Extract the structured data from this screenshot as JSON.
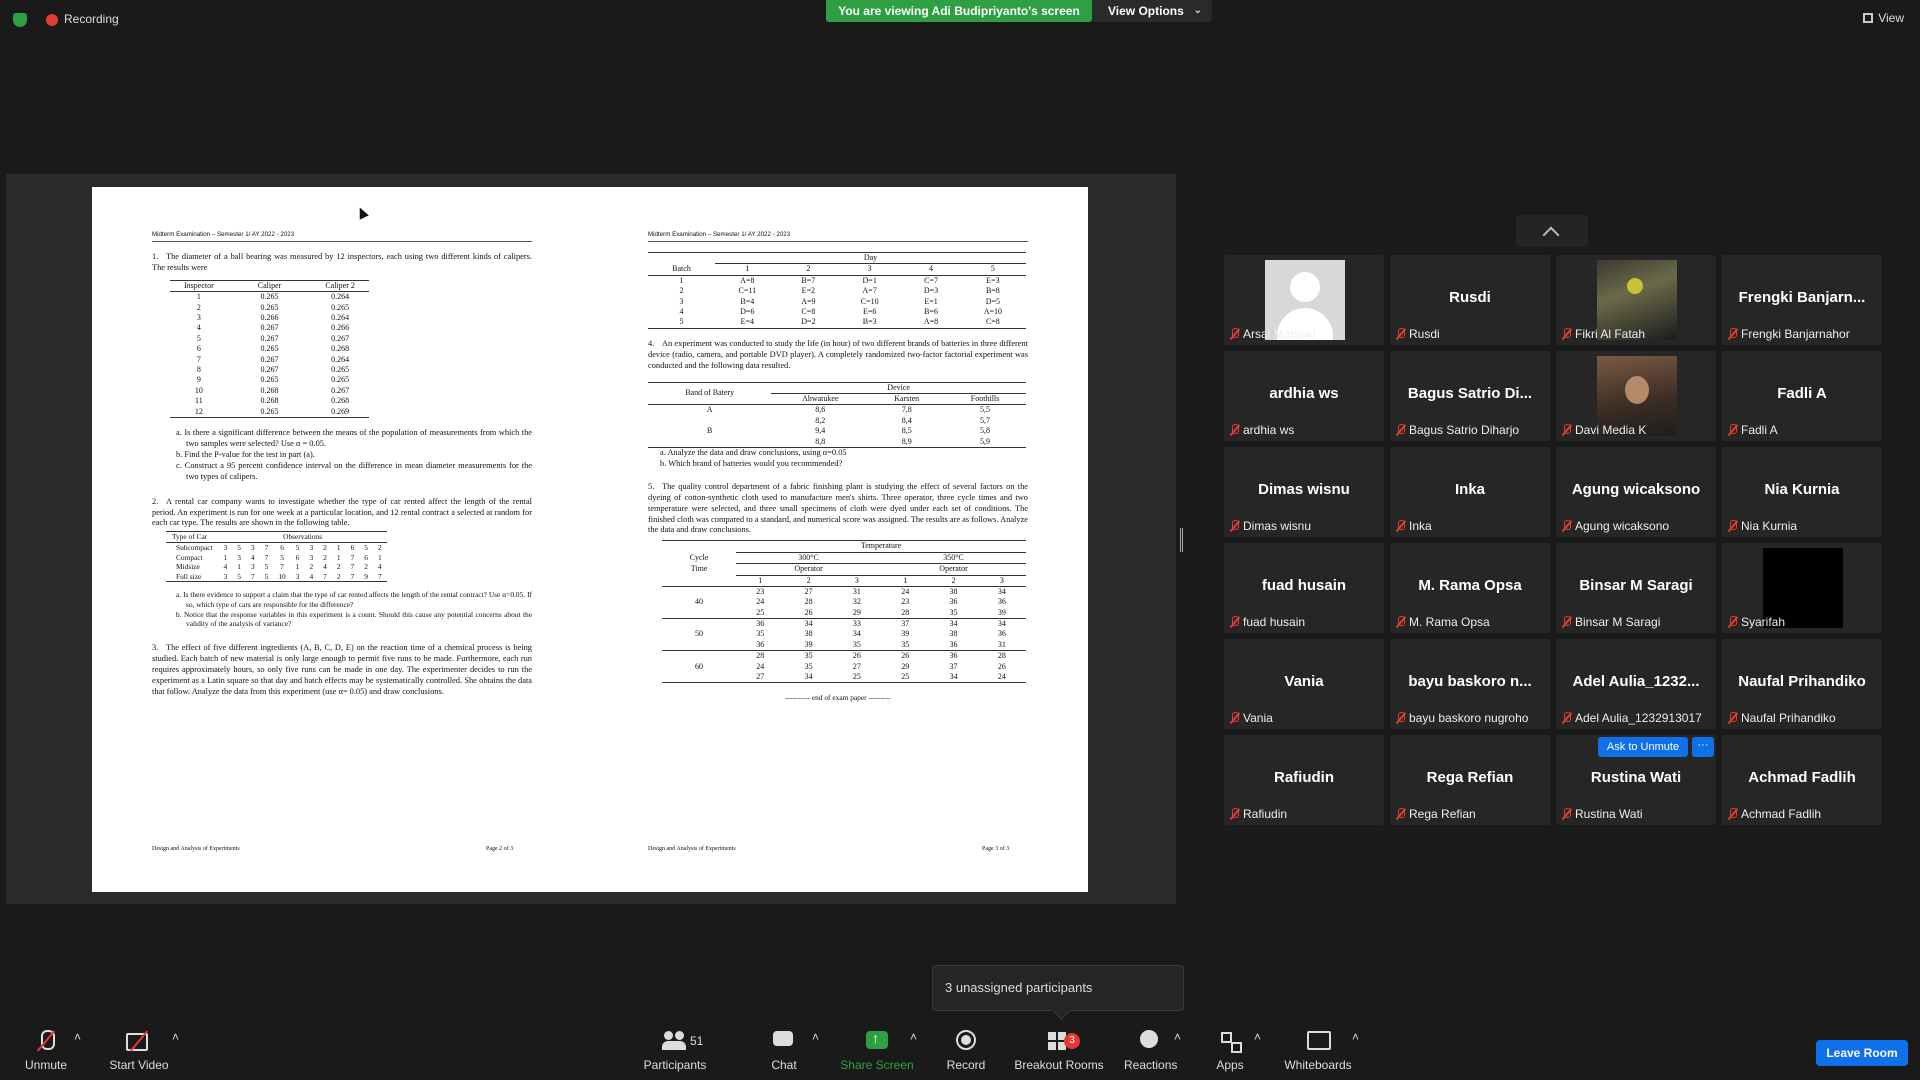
{
  "topbar": {
    "recording": "Recording",
    "banner": "You are viewing Adi Budipriyanto's screen",
    "view_options": "View Options",
    "view": "View"
  },
  "doc": {
    "page2": {
      "header": "Midterm Examination – Semester 1/ AY 2022 - 2023",
      "q1_num": "1.",
      "q1_text": "The diameter of a ball bearing was measured by 12 inspectors, each using two different kinds of calipers. The results were",
      "q1_table": {
        "headers": [
          "Inspector",
          "Caliper",
          "Caliper 2"
        ],
        "rows": [
          [
            "1",
            "0.265",
            "0.264"
          ],
          [
            "2",
            "0.265",
            "0.265"
          ],
          [
            "3",
            "0.266",
            "0.264"
          ],
          [
            "4",
            "0.267",
            "0.266"
          ],
          [
            "5",
            "0.267",
            "0.267"
          ],
          [
            "6",
            "0.265",
            "0.268"
          ],
          [
            "7",
            "0.267",
            "0.264"
          ],
          [
            "8",
            "0.267",
            "0.265"
          ],
          [
            "9",
            "0.265",
            "0.265"
          ],
          [
            "10",
            "0.268",
            "0.267"
          ],
          [
            "11",
            "0.268",
            "0.268"
          ],
          [
            "12",
            "0.265",
            "0.269"
          ]
        ]
      },
      "q1_a": "a. Is there a significant difference between the means of the population of measurements from which the two samples were selected? Use α = 0.05.",
      "q1_b": "b. Find the P-value for the test in part (a).",
      "q1_c": "c. Construct a 95 percent confidence interval on the difference in mean diameter measurements for the two types of calipers.",
      "q2_num": "2.",
      "q2_text": "A rental car company wants to investigate whether the type of car rented affect the length of the rental period. An experiment is run for one week at a particular location, and 12 rental contract a selected at random for each car type. The results are shown in the following table.",
      "q2_table": {
        "h_type": "Type of Car",
        "h_obs": "Observations",
        "rows": [
          {
            "label": "Subcompact",
            "values": [
              "3",
              "5",
              "3",
              "7",
              "6",
              "5",
              "3",
              "2",
              "1",
              "6",
              "5",
              "2"
            ]
          },
          {
            "label": "Compact",
            "values": [
              "1",
              "3",
              "4",
              "7",
              "5",
              "6",
              "3",
              "2",
              "1",
              "7",
              "6",
              "1"
            ]
          },
          {
            "label": "Midsize",
            "values": [
              "4",
              "1",
              "3",
              "5",
              "7",
              "1",
              "2",
              "4",
              "2",
              "7",
              "2",
              "4"
            ]
          },
          {
            "label": "Full size",
            "values": [
              "3",
              "5",
              "7",
              "5",
              "10",
              "3",
              "4",
              "7",
              "2",
              "7",
              "9",
              "7"
            ]
          }
        ]
      },
      "q2_a": "a. Is there evidence to support a claim that the type of car rented affects the length of the rental contract? Use α=0.05. If so, which type of cars are responsible for the difference?",
      "q2_b": "b. Notice that the response variables in this experiment is a count. Should this cause any potential concerns about the validity of the analysis of variance?",
      "q3_num": "3.",
      "q3_text": "The effect of five different ingredients (A, B, C, D, E) on the reaction time of a chemical process is being studied. Each batch of new material is only large enough to permit five runs to be made. Furthermore, each run requires approximately hours, so only five runs can be made in one day. The experimenter decides to run the experiment as a Latin square so that day and batch effects may be systematically controlled. She obtains the data that follow. Analyze the data from this experiment (use α= 0.05) and draw conclusions.",
      "footer_left": "Design and Analysis of Experiments",
      "footer_right": "Page 2 of 3"
    },
    "page3": {
      "header": "Midterm Examination – Semester 1/ AY 2022 - 2023",
      "latin": {
        "day": "Day",
        "cols": [
          "Batch",
          "1",
          "2",
          "3",
          "4",
          "5"
        ],
        "rows": [
          [
            "1",
            "A=8",
            "B=7",
            "D=1",
            "C=7",
            "E=3"
          ],
          [
            "2",
            "C=11",
            "E=2",
            "A=7",
            "D=3",
            "B=8"
          ],
          [
            "3",
            "B=4",
            "A=9",
            "C=10",
            "E=1",
            "D=5"
          ],
          [
            "4",
            "D=6",
            "C=8",
            "E=6",
            "B=6",
            "A=10"
          ],
          [
            "5",
            "E=4",
            "D=2",
            "B=3",
            "A=8",
            "C=8"
          ]
        ]
      },
      "q4_num": "4.",
      "q4_text": "An experiment was conducted to study the life (in hour) of two different brands of batteries in three different device (radio, camera, and portable DVD player). A completely randomized two-factor factorial experiment was conducted and the following data resulted.",
      "battery": {
        "band": "Band of Batery",
        "device": "Device",
        "cols": [
          "Ahwatukee",
          "Karsten",
          "Foothills"
        ],
        "rows": [
          [
            "A",
            "8,6",
            "7,8",
            "5,5"
          ],
          [
            "",
            "8,2",
            "8,4",
            "5,7"
          ],
          [
            "B",
            "9,4",
            "8,5",
            "5,8"
          ],
          [
            "",
            "8,8",
            "8,9",
            "5,9"
          ]
        ]
      },
      "q4_a": "a. Analyze the data and draw conclusions, using α=0.05",
      "q4_b": "b. Which brand of batteries would you recommended?",
      "q5_num": "5.",
      "q5_text": "The quality control department of a fabric finishing plant is studying the effect of several factors on the dyeing of cotton-synthetic cloth used to manufacture men's shirts. Three operator, three cycle times and two temperature were selected, and three small specimens of cloth were dyed under each set of conditions. The finished cloth was compared to a standard, and numerical score was assigned. The results are as follows. Analyze the data and draw conclusions.",
      "dye": {
        "cycle": "Cycle",
        "time": "Time",
        "temperature": "Temperature",
        "t1": "300°C",
        "t2": "350°C",
        "operator": "Operator",
        "ops": [
          "1",
          "2",
          "3",
          "1",
          "2",
          "3"
        ],
        "groups": [
          {
            "time": "40",
            "rows": [
              [
                "23",
                "27",
                "31",
                "24",
                "38",
                "34"
              ],
              [
                "24",
                "28",
                "32",
                "23",
                "36",
                "36"
              ],
              [
                "25",
                "26",
                "29",
                "28",
                "35",
                "39"
              ]
            ]
          },
          {
            "time": "50",
            "rows": [
              [
                "36",
                "34",
                "33",
                "37",
                "34",
                "34"
              ],
              [
                "35",
                "38",
                "34",
                "39",
                "38",
                "36"
              ],
              [
                "36",
                "39",
                "35",
                "35",
                "36",
                "31"
              ]
            ]
          },
          {
            "time": "60",
            "rows": [
              [
                "28",
                "35",
                "26",
                "26",
                "36",
                "28"
              ],
              [
                "24",
                "35",
                "27",
                "29",
                "37",
                "26"
              ],
              [
                "27",
                "34",
                "25",
                "25",
                "34",
                "24"
              ]
            ]
          }
        ]
      },
      "end": "---------- end of exam paper ---------",
      "footer_left": "Design and Analysis of Experiments",
      "footer_right": "Page 3 of 3"
    }
  },
  "participants": [
    {
      "big": "",
      "name": "Arsal Marsuki",
      "kind": "avatar"
    },
    {
      "big": "Rusdi",
      "name": "Rusdi",
      "kind": "text"
    },
    {
      "big": "",
      "name": "Fikri Al Fatah",
      "kind": "photo1"
    },
    {
      "big": "Frengki  Banjarn...",
      "name": "Frengki Banjarnahor",
      "kind": "text"
    },
    {
      "big": "ardhia ws",
      "name": "ardhia ws",
      "kind": "text"
    },
    {
      "big": "Bagus Satrio Di...",
      "name": "Bagus Satrio Diharjo",
      "kind": "text"
    },
    {
      "big": "",
      "name": "Davi Media K",
      "kind": "photo2"
    },
    {
      "big": "Fadli A",
      "name": "Fadli A",
      "kind": "text"
    },
    {
      "big": "Dimas wisnu",
      "name": "Dimas wisnu",
      "kind": "text"
    },
    {
      "big": "Inka",
      "name": "Inka",
      "kind": "text"
    },
    {
      "big": "Agung wicaksono",
      "name": "Agung wicaksono",
      "kind": "text"
    },
    {
      "big": "Nia Kurnia",
      "name": "Nia Kurnia",
      "kind": "text"
    },
    {
      "big": "fuad husain",
      "name": "fuad husain",
      "kind": "text"
    },
    {
      "big": "M. Rama Opsa",
      "name": "M. Rama Opsa",
      "kind": "text"
    },
    {
      "big": "Binsar M Saragi",
      "name": "Binsar M Saragi",
      "kind": "text"
    },
    {
      "big": "",
      "name": "Syarifah",
      "kind": "black"
    },
    {
      "big": "Vania",
      "name": "Vania",
      "kind": "text"
    },
    {
      "big": "bayu  baskoro  n...",
      "name": "bayu baskoro nugroho",
      "kind": "text"
    },
    {
      "big": "Adel  Aulia_1232...",
      "name": "Adel Aulia_1232913017",
      "kind": "text"
    },
    {
      "big": "Naufal Prihandiko",
      "name": "Naufal Prihandiko",
      "kind": "text"
    },
    {
      "big": "Rafiudin",
      "name": "Rafiudin",
      "kind": "text"
    },
    {
      "big": "Rega Refian",
      "name": "Rega Refian",
      "kind": "text"
    },
    {
      "big": "Rustina Wati",
      "name": "Rustina Wati",
      "kind": "text"
    },
    {
      "big": "Achmad Fadlih",
      "name": "Achmad Fadlih",
      "kind": "text"
    }
  ],
  "ask_unmute": "Ask to Unmute",
  "ask_more": "···",
  "tooltip": "3 unassigned participants",
  "toolbar": {
    "unmute": "Unmute",
    "start_video": "Start Video",
    "participants": "Participants",
    "participants_count": "51",
    "chat": "Chat",
    "share_screen": "Share Screen",
    "record": "Record",
    "breakout_rooms": "Breakout Rooms",
    "breakout_badge": "3",
    "reactions": "Reactions",
    "apps": "Apps",
    "whiteboards": "Whiteboards",
    "leave_room": "Leave Room"
  },
  "colors": {
    "banner_green": "#2ea043",
    "zoom_blue": "#0e71eb",
    "muted_red": "#e53935"
  }
}
